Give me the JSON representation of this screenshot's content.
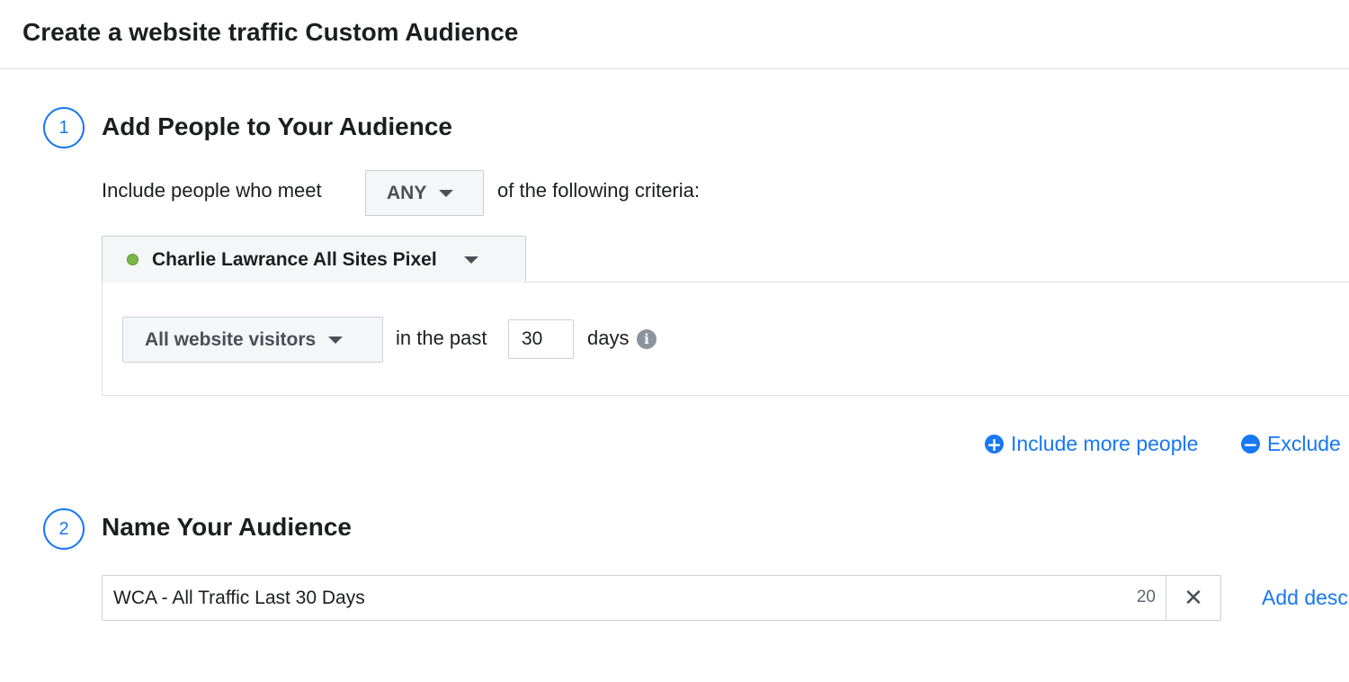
{
  "header": {
    "title": "Create a website traffic Custom Audience"
  },
  "step1": {
    "number": "1",
    "title": "Add People to Your Audience",
    "include_prefix": "Include people who meet",
    "match_value": "ANY",
    "include_suffix": "of the following criteria:",
    "pixel_name": "Charlie Lawrance All Sites Pixel",
    "rule": {
      "event_value": "All website visitors",
      "in_the_past": "in the past",
      "days_value": "30",
      "days_label": "days"
    },
    "include_more_label": "Include more people",
    "exclude_label": "Exclude"
  },
  "step2": {
    "number": "2",
    "title": "Name Your Audience",
    "name_value": "WCA - All Traffic Last 30 Days",
    "char_count": "20",
    "add_description_label": "Add desc"
  },
  "colors": {
    "accent": "#1877f2",
    "pixel_status": "#7ab648",
    "border": "#ccd0d5"
  }
}
